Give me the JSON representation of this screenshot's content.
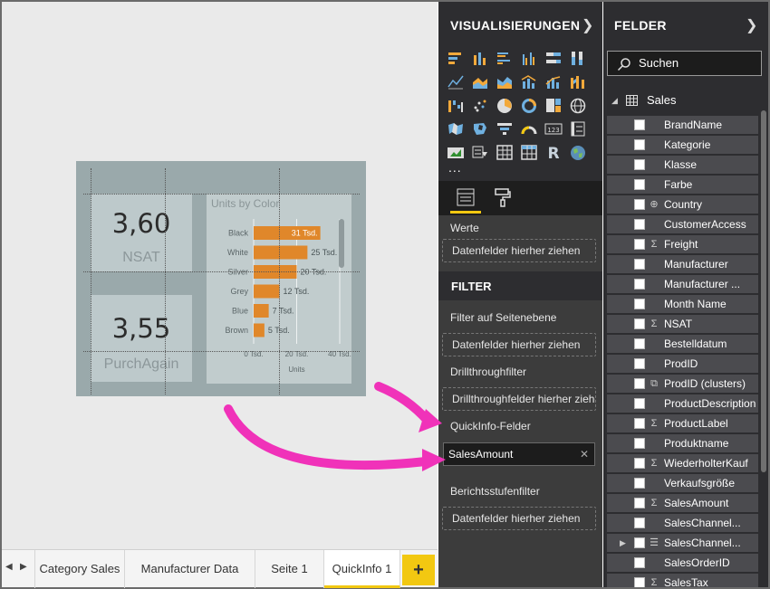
{
  "canvas": {
    "cards": [
      {
        "value": "3,60",
        "label": "NSAT"
      },
      {
        "value": "3,55",
        "label": "PurchAgain"
      }
    ]
  },
  "chart_data": {
    "type": "bar",
    "title": "Units by Color",
    "categories": [
      "Black",
      "White",
      "Silver",
      "Grey",
      "Blue",
      "Brown"
    ],
    "values": [
      31,
      25,
      20,
      12,
      7,
      5
    ],
    "data_labels": [
      "31 Tsd.",
      "25 Tsd.",
      "20 Tsd.",
      "12 Tsd.",
      "7 Tsd.",
      "5 Tsd."
    ],
    "x_ticks": [
      "0 Tsd.",
      "20 Tsd.",
      "40 Tsd."
    ],
    "xlabel": "Units",
    "xlim": [
      0,
      40
    ],
    "bar_color": "#e0872a",
    "grid": true
  },
  "tabs": [
    {
      "label": "Category Sales"
    },
    {
      "label": "Manufacturer Data"
    },
    {
      "label": "Seite 1"
    },
    {
      "label": "QuickInfo 1"
    }
  ],
  "tab_add": "+",
  "viz_pane": {
    "title": "VISUALISIERUNGEN",
    "more": "...",
    "werte_label": "Werte",
    "werte_placeholder": "Datenfelder hierher ziehen"
  },
  "filter_pane": {
    "title": "FILTER",
    "page_label": "Filter auf Seitenebene",
    "page_placeholder": "Datenfelder hierher ziehen",
    "drill_label": "Drillthroughfilter",
    "drill_placeholder": "Drillthroughfelder hierher ziehen",
    "tooltip_label": "QuickInfo-Felder",
    "tooltip_value": "SalesAmount",
    "report_label": "Berichtsstufenfilter",
    "report_placeholder": "Datenfelder hierher ziehen"
  },
  "fields_pane": {
    "title": "FELDER",
    "search_placeholder": "Suchen",
    "table_name": "Sales",
    "fields": [
      {
        "name": "BrandName",
        "type": ""
      },
      {
        "name": "Kategorie",
        "type": ""
      },
      {
        "name": "Klasse",
        "type": ""
      },
      {
        "name": "Farbe",
        "type": ""
      },
      {
        "name": "Country",
        "type": "globe"
      },
      {
        "name": "CustomerAccess",
        "type": ""
      },
      {
        "name": "Freight",
        "type": "sigma"
      },
      {
        "name": "Manufacturer",
        "type": ""
      },
      {
        "name": "Manufacturer ...",
        "type": ""
      },
      {
        "name": "Month Name",
        "type": ""
      },
      {
        "name": "NSAT",
        "type": "sigma"
      },
      {
        "name": "Bestelldatum",
        "type": ""
      },
      {
        "name": "ProdID",
        "type": ""
      },
      {
        "name": "ProdID (clusters)",
        "type": "cluster"
      },
      {
        "name": "ProductDescription",
        "type": ""
      },
      {
        "name": "ProductLabel",
        "type": "sigma"
      },
      {
        "name": "Produktname",
        "type": ""
      },
      {
        "name": "WiederholterKauf",
        "type": "sigma"
      },
      {
        "name": "Verkaufsgröße",
        "type": ""
      },
      {
        "name": "SalesAmount",
        "type": "sigma"
      },
      {
        "name": "SalesChannel...",
        "type": ""
      },
      {
        "name": "SalesChannel...",
        "type": "hierarchy"
      },
      {
        "name": "SalesOrderID",
        "type": ""
      },
      {
        "name": "SalesTax",
        "type": "sigma"
      }
    ]
  },
  "colors": {
    "accent": "#f2c811",
    "annotation_arrow": "#f032b9",
    "pane_bg": "#2d2d30"
  }
}
